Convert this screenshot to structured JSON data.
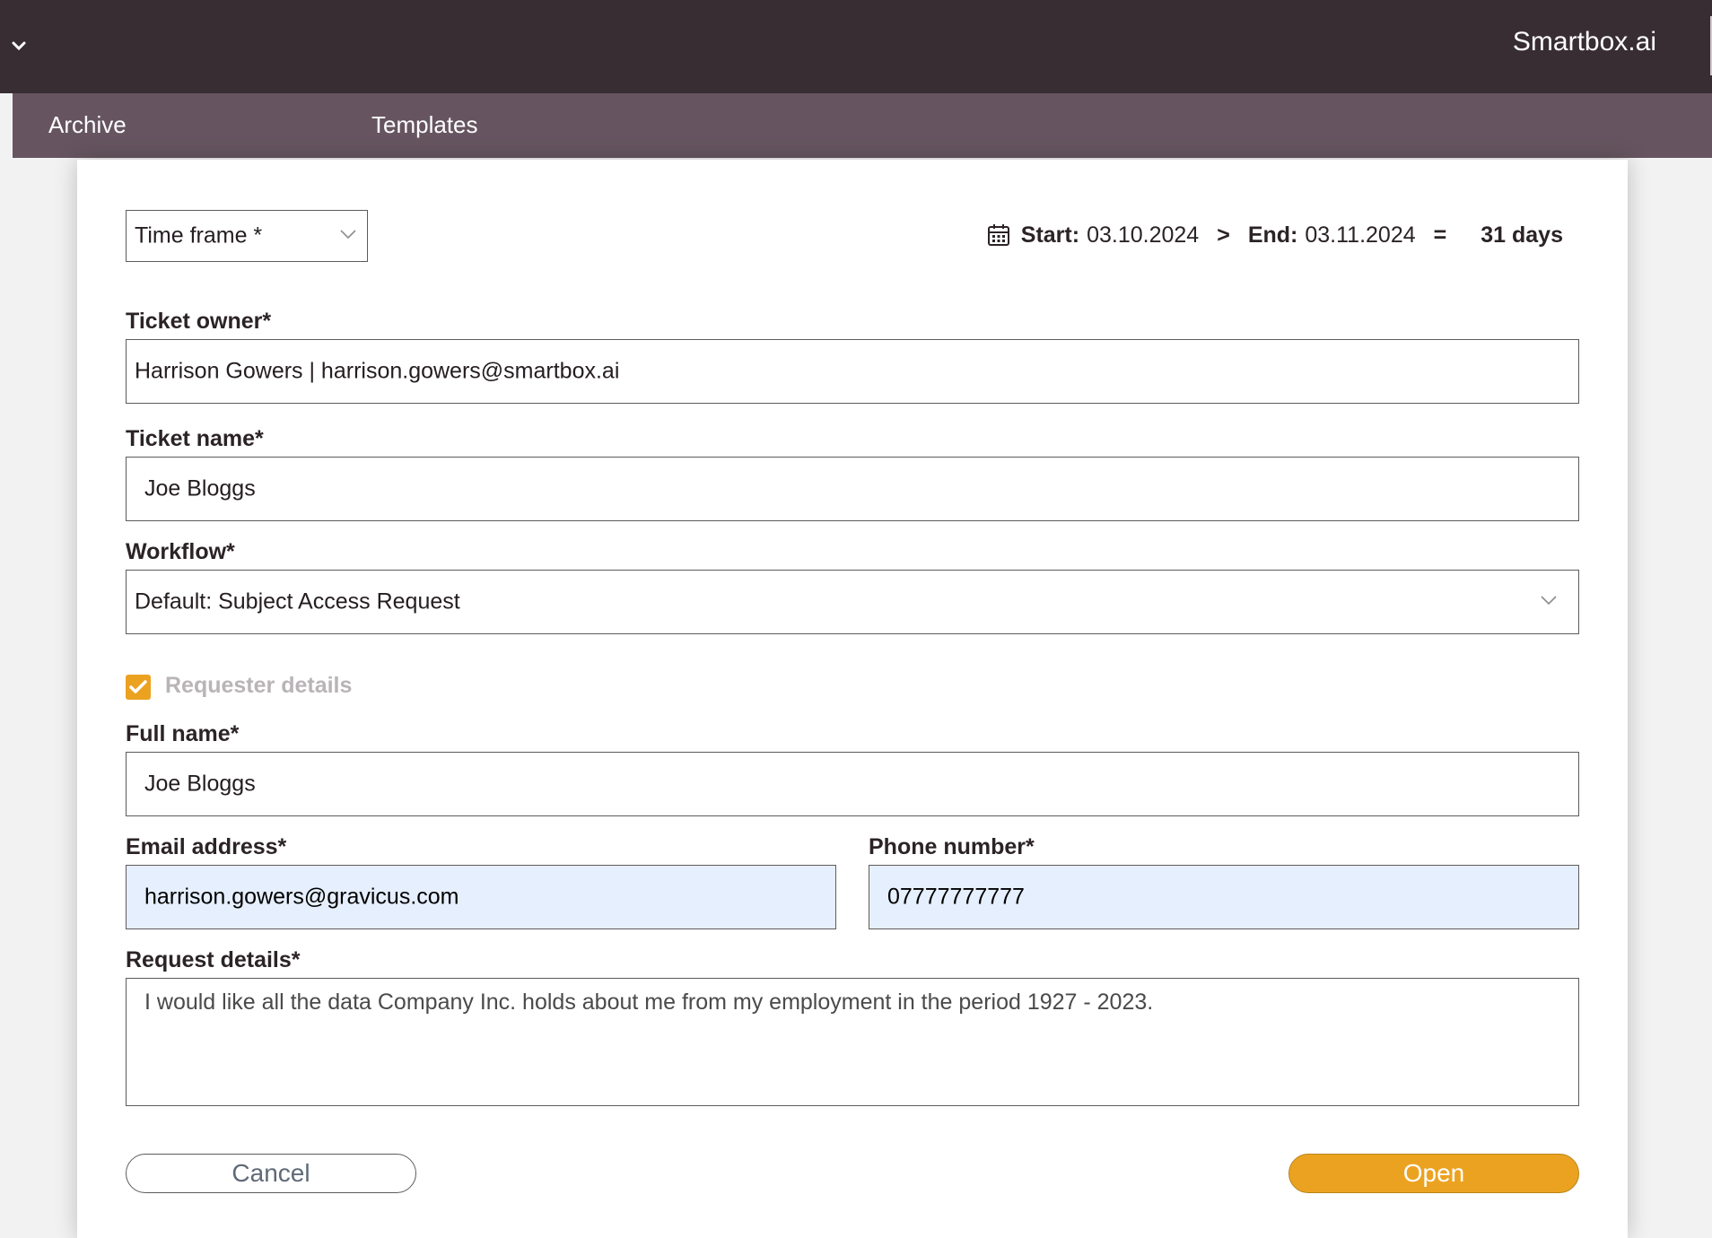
{
  "header": {
    "brand": "Smartbox.ai"
  },
  "nav": {
    "tabs": [
      {
        "label": "Archive"
      },
      {
        "label": "Templates"
      }
    ]
  },
  "form": {
    "time_frame": {
      "value": "Time frame *"
    },
    "date_range": {
      "start_label": "Start:",
      "start_value": "03.10.2024",
      "arrow": ">",
      "end_label": "End:",
      "end_value": "03.11.2024",
      "equals": "=",
      "duration": "31 days"
    },
    "ticket_owner": {
      "label": "Ticket owner*",
      "value": "Harrison Gowers | harrison.gowers@smartbox.ai"
    },
    "ticket_name": {
      "label": "Ticket name*",
      "value": "Joe Bloggs"
    },
    "workflow": {
      "label": "Workflow*",
      "value": "Default: Subject Access Request"
    },
    "requester_details": {
      "label": "Requester details",
      "checked": true
    },
    "full_name": {
      "label": "Full name*",
      "value": "Joe Bloggs"
    },
    "email": {
      "label": "Email address*",
      "value": "harrison.gowers@gravicus.com"
    },
    "phone": {
      "label": "Phone number*",
      "value": "07777777777"
    },
    "request_details": {
      "label": "Request details*",
      "value": "I would like all the data Company Inc. holds about me from my employment in the period 1927 - 2023."
    }
  },
  "actions": {
    "cancel_label": "Cancel",
    "open_label": "Open"
  },
  "colors": {
    "topbar": "#382d33",
    "navbar": "#665560",
    "accent": "#eca221",
    "autofill": "#e6effd"
  }
}
